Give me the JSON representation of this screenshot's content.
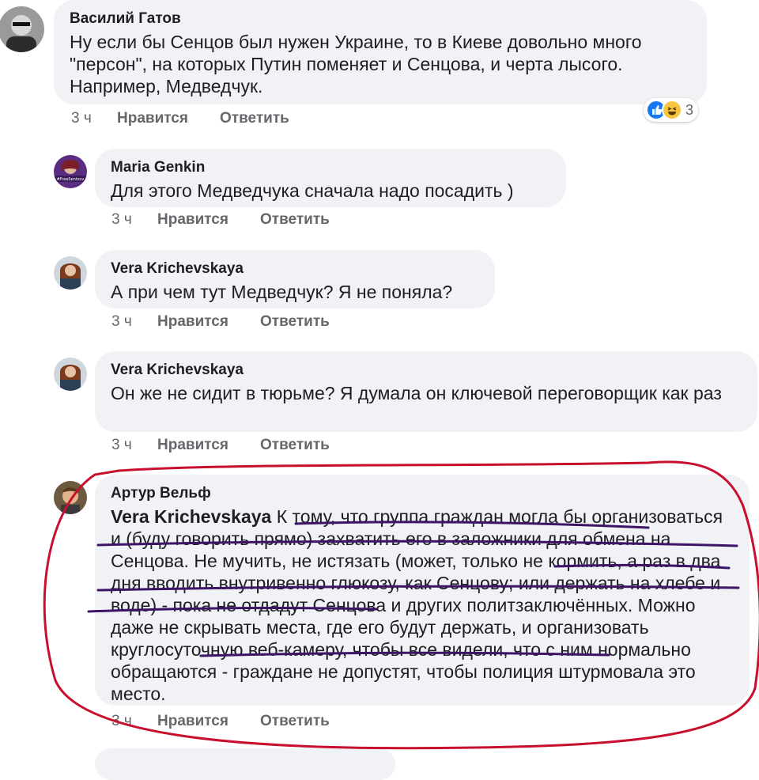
{
  "comments": [
    {
      "author": "Василий Гатов",
      "text": "Ну если бы Сенцов был нужен Украине, то в Киеве довольно много \"персон\", на которых Путин поменяет и Сенцова, и черта лысого. Например, Медведчук.",
      "time": "3 ч",
      "like": "Нравится",
      "reply": "Ответить",
      "reactions": {
        "count": "3",
        "icons": [
          "like-icon",
          "haha-icon"
        ]
      }
    },
    {
      "author": "Maria Genkin",
      "text": "Для этого Медведчука сначала надо посадить )",
      "time": "3 ч",
      "like": "Нравится",
      "reply": "Ответить",
      "avatar_badge": "#FreeSentsov"
    },
    {
      "author": "Vera Krichevskaya",
      "text": "А при чем тут Медведчук? Я не поняла?",
      "time": "3 ч",
      "like": "Нравится",
      "reply": "Ответить"
    },
    {
      "author": "Vera Krichevskaya",
      "text": "Он же не сидит в тюрьме? Я думала он ключевой переговорщик как раз",
      "time": "3 ч",
      "like": "Нравится",
      "reply": "Ответить"
    },
    {
      "author": "Артур Вельф",
      "mention": "Vera Krichevskaya",
      "text": "К тому, что группа граждан могла бы организоваться и (буду говорить прямо) захватить его в заложники для обмена на Сенцова. Не мучить, не истязать (может, только не кормить, а раз в два дня вводить внутривенно глюкозу, как Сенцову; или держать на хлебе и воде) - пока не отдадут Сенцова и других политзаключённых. Можно даже не скрывать места, где его будут держать, и организовать круглосуточную веб-камеру, чтобы все видели, что с ним нормально обращаются - граждане не допустят, чтобы полиция штурмовала это место.",
      "time": "3 ч",
      "like": "Нравится",
      "reply": "Ответить"
    }
  ],
  "colors": {
    "bubble": "#f0f2f5",
    "meta_text": "#65676b",
    "circle_annotation": "#c8102e",
    "underline_annotation": "#3d1466",
    "like_reaction": "#1877f2",
    "haha_reaction": "#f7c542"
  }
}
